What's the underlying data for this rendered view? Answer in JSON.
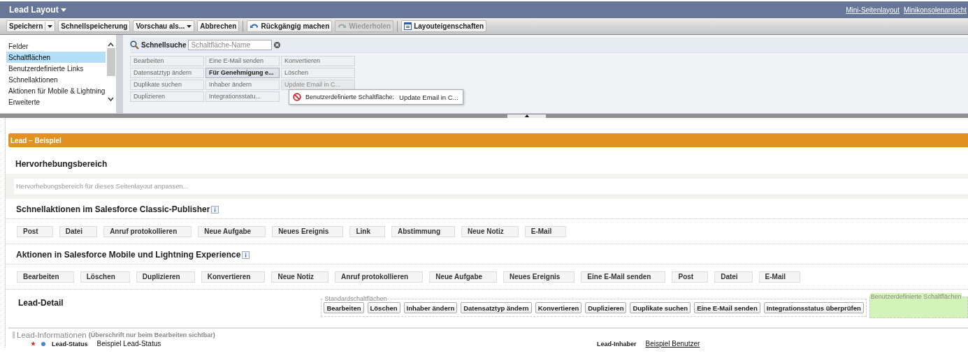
{
  "header": {
    "title": "Lead Layout",
    "links": [
      "Mini-Seitenlayout",
      "Minikonsolenansicht"
    ]
  },
  "toolbar": [
    {
      "label": "Speichern",
      "kind": "split",
      "disabled": false
    },
    {
      "label": "Schnellspeicherung",
      "kind": "plain",
      "disabled": false
    },
    {
      "label": "Vorschau als...",
      "kind": "menu",
      "disabled": false
    },
    {
      "label": "Abbrechen",
      "kind": "plain",
      "disabled": false
    },
    {
      "kind": "separator"
    },
    {
      "label": "Rückgängig machen",
      "kind": "undo",
      "disabled": false
    },
    {
      "label": "Wiederholen",
      "kind": "redo",
      "disabled": true
    },
    {
      "kind": "separator"
    },
    {
      "label": "Layouteigenschaften",
      "kind": "properties",
      "disabled": false
    }
  ],
  "palette": {
    "categories": [
      {
        "label": "Felder",
        "selected": false
      },
      {
        "label": "Schaltflächen",
        "selected": true
      },
      {
        "label": "Benutzerdefinierte Links",
        "selected": false
      },
      {
        "label": "Schnellaktionen",
        "selected": false
      },
      {
        "label": "Aktionen für Mobile & Lightning",
        "selected": false
      },
      {
        "label": "Erweiterte",
        "selected": false
      }
    ],
    "search": {
      "label": "Schnellsuche",
      "placeholder": "Schaltfläche-Name"
    },
    "buttons": [
      {
        "label": "Bearbeiten",
        "selected": false,
        "disabled": false
      },
      {
        "label": "Eine E-Mail senden",
        "selected": false,
        "disabled": false
      },
      {
        "label": "Konvertieren",
        "selected": false,
        "disabled": false
      },
      {
        "label": "Datensatztyp ändern",
        "selected": false,
        "disabled": false
      },
      {
        "label": "Für Genehmigung e...",
        "selected": true,
        "disabled": false
      },
      {
        "label": "Löschen",
        "selected": false,
        "disabled": false
      },
      {
        "label": "Duplikate suchen",
        "selected": false,
        "disabled": false
      },
      {
        "label": "Inhaber ändern",
        "selected": false,
        "disabled": false
      },
      {
        "label": "Update Email in C...",
        "selected": false,
        "disabled": true
      },
      {
        "label": "Duplizieren",
        "selected": false,
        "disabled": false
      },
      {
        "label": "Integrationsstatu...",
        "selected": false,
        "disabled": false
      }
    ],
    "tooltip": {
      "label": "Benutzerdefinierte Schaltfläche:",
      "value": "Update Email in C..."
    }
  },
  "layout": {
    "title": "Lead – Beispiel",
    "highlights": {
      "heading": "Hervorhebungsbereich",
      "placeholder": "Hervorhebungsbereich für dieses Seitenlayout anpassen..."
    },
    "action_sections": [
      {
        "heading": "Schnellaktionen im Salesforce Classic-Publisher",
        "actions": [
          "Post",
          "Datei",
          "Anruf protokollieren",
          "Neue Aufgabe",
          "Neues Ereignis",
          "Link",
          "Abstimmung",
          "Neue Notiz",
          "E-Mail"
        ]
      },
      {
        "heading": "Aktionen in Salesforce Mobile und Lightning Experience",
        "actions": [
          "Bearbeiten",
          "Löschen",
          "Duplizieren",
          "Konvertieren",
          "Neue Notiz",
          "Anruf protokollieren",
          "Neue Aufgabe",
          "Neues Ereignis",
          "Eine E-Mail senden",
          "Post",
          "Datei",
          "E-Mail"
        ]
      }
    ],
    "detail": {
      "heading": "Lead-Detail",
      "standard_legend": "Standardschaltflächen",
      "standard_buttons": [
        "Bearbeiten",
        "Löschen",
        "Inhaber ändern",
        "Datensatztyp ändern",
        "Konvertieren",
        "Duplizieren",
        "Duplikate suchen",
        "Eine E-Mail senden",
        "Integrationsstatus überprüfen"
      ],
      "custom_legend": "Benutzerdefinierte Schaltflächen"
    },
    "info_section": {
      "heading": "Lead-Informationen",
      "note": "(Überschrift nur beim Bearbeiten sichtbar)",
      "fields": [
        {
          "label": "Lead-Status",
          "value": "Beispiel Lead-Status",
          "required": true,
          "kind": "picklist"
        },
        {
          "label": "Lead-Inhaber",
          "value": "Beispiel Benutzer",
          "required": false,
          "kind": "lookup"
        }
      ]
    }
  }
}
